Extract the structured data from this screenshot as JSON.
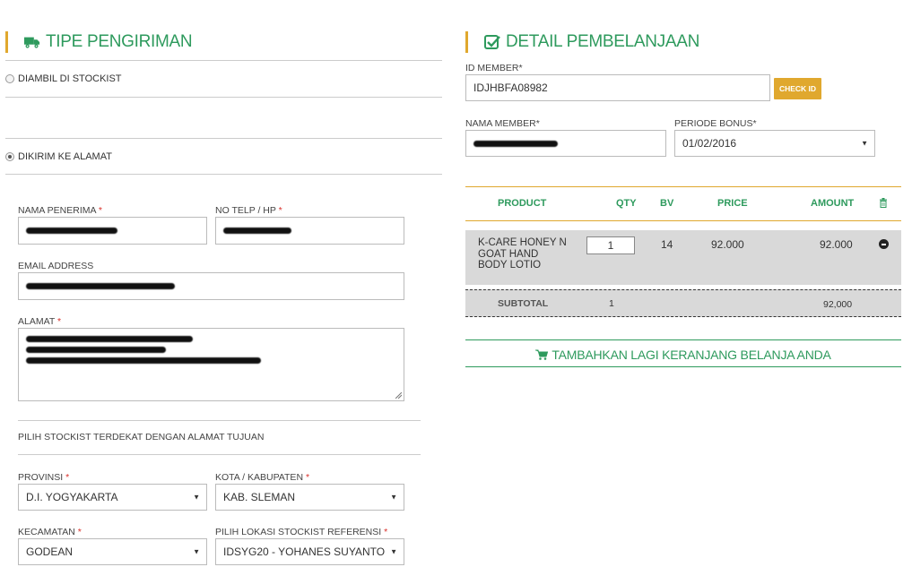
{
  "shipping": {
    "title": "TIPE PENGIRIMAN",
    "option_pickup": "DIAMBIL DI STOCKIST",
    "option_delivery": "DIKIRIM KE ALAMAT",
    "recipient_name_label": "NAMA PENERIMA",
    "phone_label": "NO TELP / HP",
    "email_label": "EMAIL ADDRESS",
    "address_label": "ALAMAT",
    "stockist_heading": "PILIH STOCKIST TERDEKAT DENGAN ALAMAT TUJUAN",
    "province_label": "PROVINSI",
    "province_value": "D.I. YOGYAKARTA",
    "city_label": "KOTA / KABUPATEN",
    "city_value": "KAB. SLEMAN",
    "district_label": "KECAMATAN",
    "district_value": "GODEAN",
    "stockist_ref_label": "PILIH LOKASI STOCKIST REFERENSI",
    "stockist_ref_value": "IDSYG20 - YOHANES SUYANTO",
    "required_mark": "*"
  },
  "detail": {
    "title": "DETAIL PEMBELANJAAN",
    "member_id_label": "ID MEMBER*",
    "member_id_value": "IDJHBFA08982",
    "check_id_button": "CHECK ID",
    "member_name_label": "NAMA MEMBER*",
    "bonus_period_label": "PERIODE BONUS*",
    "bonus_period_value": "01/02/2016"
  },
  "cart": {
    "headers": {
      "product": "PRODUCT",
      "qty": "QTY",
      "bv": "BV",
      "price": "PRICE",
      "amount": "AMOUNT"
    },
    "rows": [
      {
        "product_line1": "K-CARE HONEY N",
        "product_line2": "GOAT HAND",
        "product_line3": "BODY LOTIO",
        "qty": "1",
        "bv": "14",
        "price": "92.000",
        "amount": "92.000"
      }
    ],
    "subtotal_label": "SUBTOTAL",
    "subtotal_qty": "1",
    "subtotal_amount": "92,000",
    "add_more_label": "TAMBAHKAN LAGI KERANJANG BELANJA ANDA"
  },
  "colors": {
    "accent_green": "#2e9a5d",
    "accent_orange": "#e0a82e",
    "row_gray": "#d9d9d9"
  },
  "icons": {
    "shipping": "truck-icon",
    "detail": "check-square-icon",
    "trash": "trash-icon",
    "remove": "minus-circle-icon",
    "cart": "cart-icon"
  }
}
